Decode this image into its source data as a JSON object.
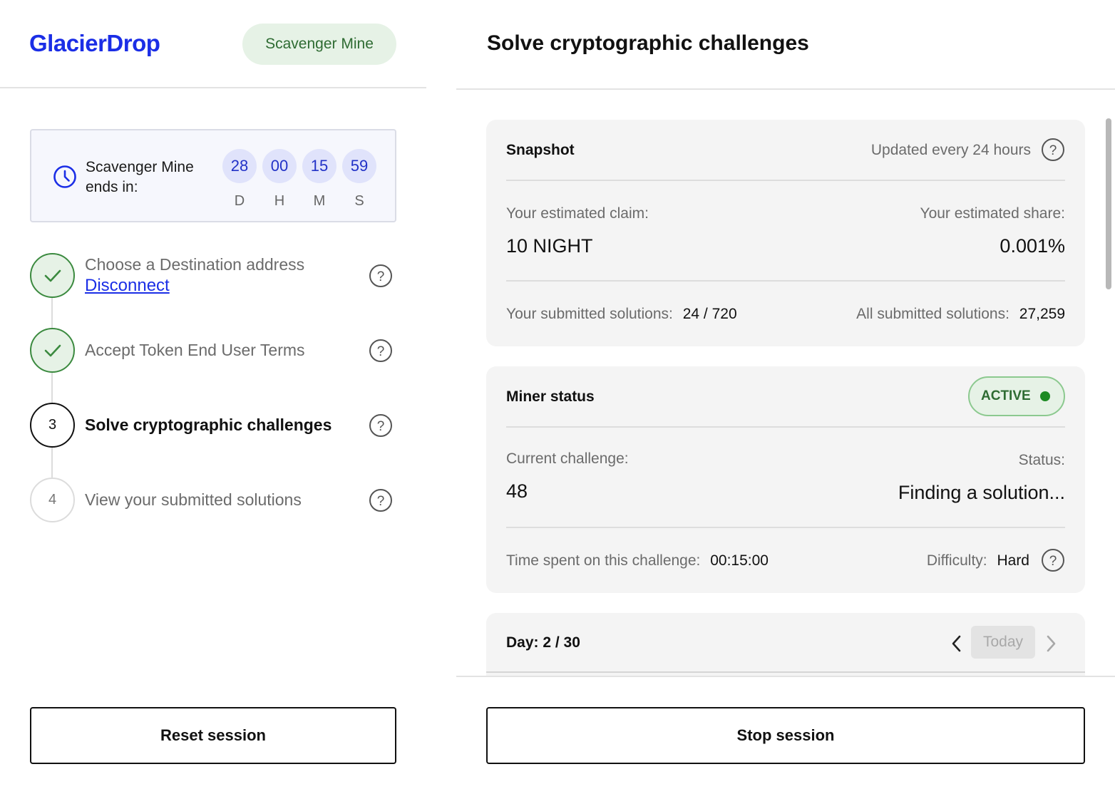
{
  "brand": {
    "logo": "GlacierDrop",
    "mode_pill": "Scavenger Mine"
  },
  "countdown": {
    "label": "Scavenger Mine ends in:",
    "units": [
      {
        "value": "28",
        "caption": "D"
      },
      {
        "value": "00",
        "caption": "H"
      },
      {
        "value": "15",
        "caption": "M"
      },
      {
        "value": "59",
        "caption": "S"
      }
    ]
  },
  "steps": [
    {
      "title": "Choose a Destination address",
      "link": "Disconnect",
      "state": "done"
    },
    {
      "title": "Accept Token End User Terms",
      "state": "done"
    },
    {
      "number": "3",
      "title": "Solve cryptographic challenges",
      "state": "current"
    },
    {
      "number": "4",
      "title": "View your submitted solutions",
      "state": "todo"
    }
  ],
  "left_button": "Reset session",
  "page_title": "Solve cryptographic challenges",
  "snapshot": {
    "title": "Snapshot",
    "update_note": "Updated every 24 hours",
    "claim_label": "Your estimated claim:",
    "claim_value": "10 NIGHT",
    "share_label": "Your estimated share:",
    "share_value": "0.001%",
    "your_solutions_label": "Your submitted solutions:",
    "your_solutions_value": "24 / 720",
    "all_solutions_label": "All submitted solutions:",
    "all_solutions_value": "27,259"
  },
  "miner": {
    "title": "Miner status",
    "badge": "ACTIVE",
    "challenge_label": "Current challenge:",
    "challenge_value": "48",
    "status_label": "Status:",
    "status_value": "Finding a solution...",
    "time_label": "Time spent on this challenge:",
    "time_value": "00:15:00",
    "difficulty_label": "Difficulty:",
    "difficulty_value": "Hard"
  },
  "day": {
    "label": "Day: 2 / 30",
    "today_button": "Today"
  },
  "right_button": "Stop session",
  "colors": {
    "brand_blue": "#1b2ee6",
    "success_green": "#3b8a3f",
    "active_dot": "#1d8a23"
  },
  "icons": [
    "clock-icon",
    "check-icon",
    "help-icon",
    "chevron-left-icon",
    "chevron-right-icon"
  ]
}
